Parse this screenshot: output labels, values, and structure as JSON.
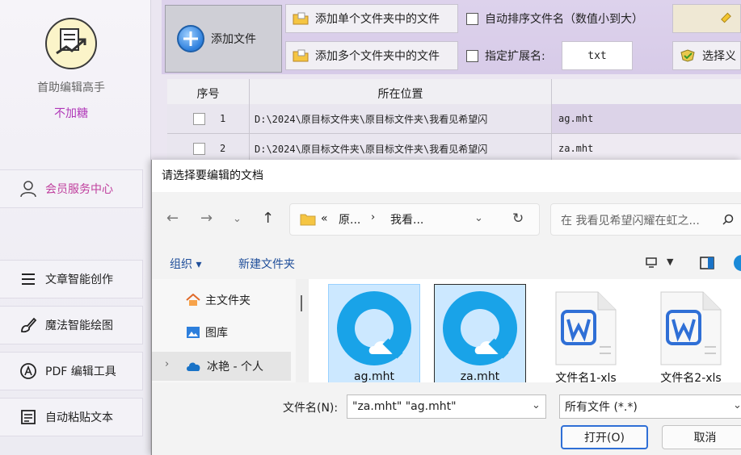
{
  "sidebar": {
    "app_name": "首助编辑高手",
    "app_sub": "不加糖",
    "member_center": "会员服务中心",
    "items": [
      {
        "label": "文章智能创作",
        "icon": "menu-lines-icon"
      },
      {
        "label": "魔法智能绘图",
        "icon": "brush-icon"
      },
      {
        "label": "PDF 编辑工具",
        "icon": "pdf-icon"
      },
      {
        "label": "自动粘贴文本",
        "icon": "document-icon"
      }
    ]
  },
  "toolbar": {
    "add_file": "添加文件",
    "add_single_folder": "添加单个文件夹中的文件",
    "add_multi_folder": "添加多个文件夹中的文件",
    "auto_sort": "自动排序文件名（数值小到大）",
    "specify_ext": "指定扩展名:",
    "ext_value": "txt",
    "select": "选择义"
  },
  "table": {
    "headers": [
      "序号",
      "所在位置"
    ],
    "rows": [
      {
        "index": "1",
        "path": "D:\\2024\\原目标文件夹\\原目标文件夹\\我看见希望闪",
        "name": "ag.mht"
      },
      {
        "index": "2",
        "path": "D:\\2024\\原目标文件夹\\原目标文件夹\\我看见希望闪",
        "name": "za.mht"
      }
    ]
  },
  "dialog": {
    "title": "请选择要编辑的文档",
    "breadcrumb": [
      "原...",
      "我看..."
    ],
    "search_placeholder": "在 我看见希望闪耀在虹之...",
    "organize": "组织 ▾",
    "new_folder": "新建文件夹",
    "nav_items": [
      {
        "label": "主文件夹",
        "icon": "home-icon"
      },
      {
        "label": "图库",
        "icon": "gallery-icon"
      },
      {
        "label": "冰艳 - 个人",
        "icon": "cloud-icon"
      }
    ],
    "files": [
      {
        "name": "ag.mht",
        "type": "browser"
      },
      {
        "name": "za.mht",
        "type": "browser"
      },
      {
        "name": "文件名1-xls",
        "type": "word"
      },
      {
        "name": "文件名2-xls",
        "type": "word"
      }
    ],
    "filename_label": "文件名(N):",
    "filename_value": "\"za.mht\" \"ag.mht\"",
    "filter_value": "所有文件 (*.*)",
    "open_button": "打开(O)",
    "cancel_button": "取消"
  }
}
